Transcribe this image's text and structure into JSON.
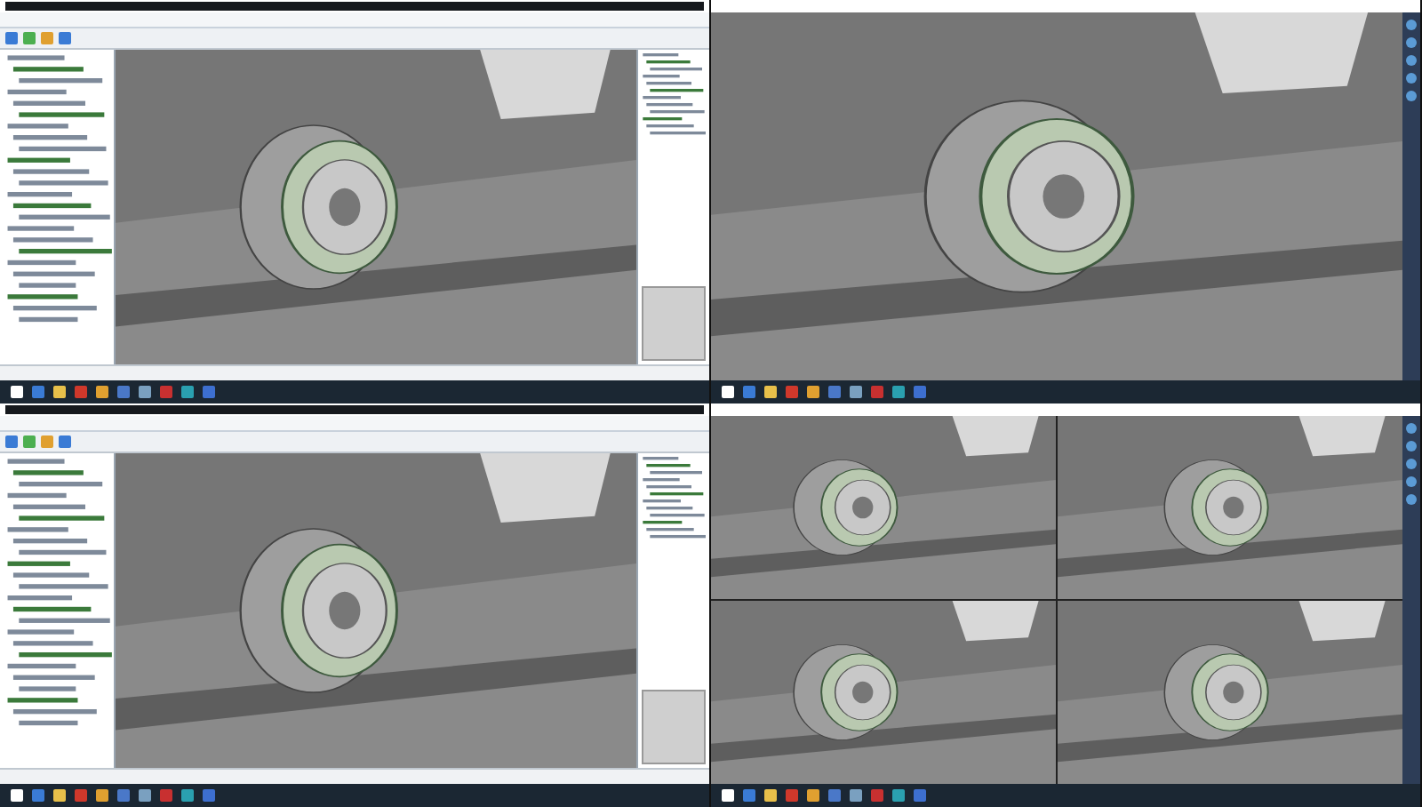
{
  "screens": [
    {
      "kind": "cad-app"
    },
    {
      "kind": "viewer"
    },
    {
      "kind": "cad-app"
    },
    {
      "kind": "viewer-split"
    }
  ]
}
